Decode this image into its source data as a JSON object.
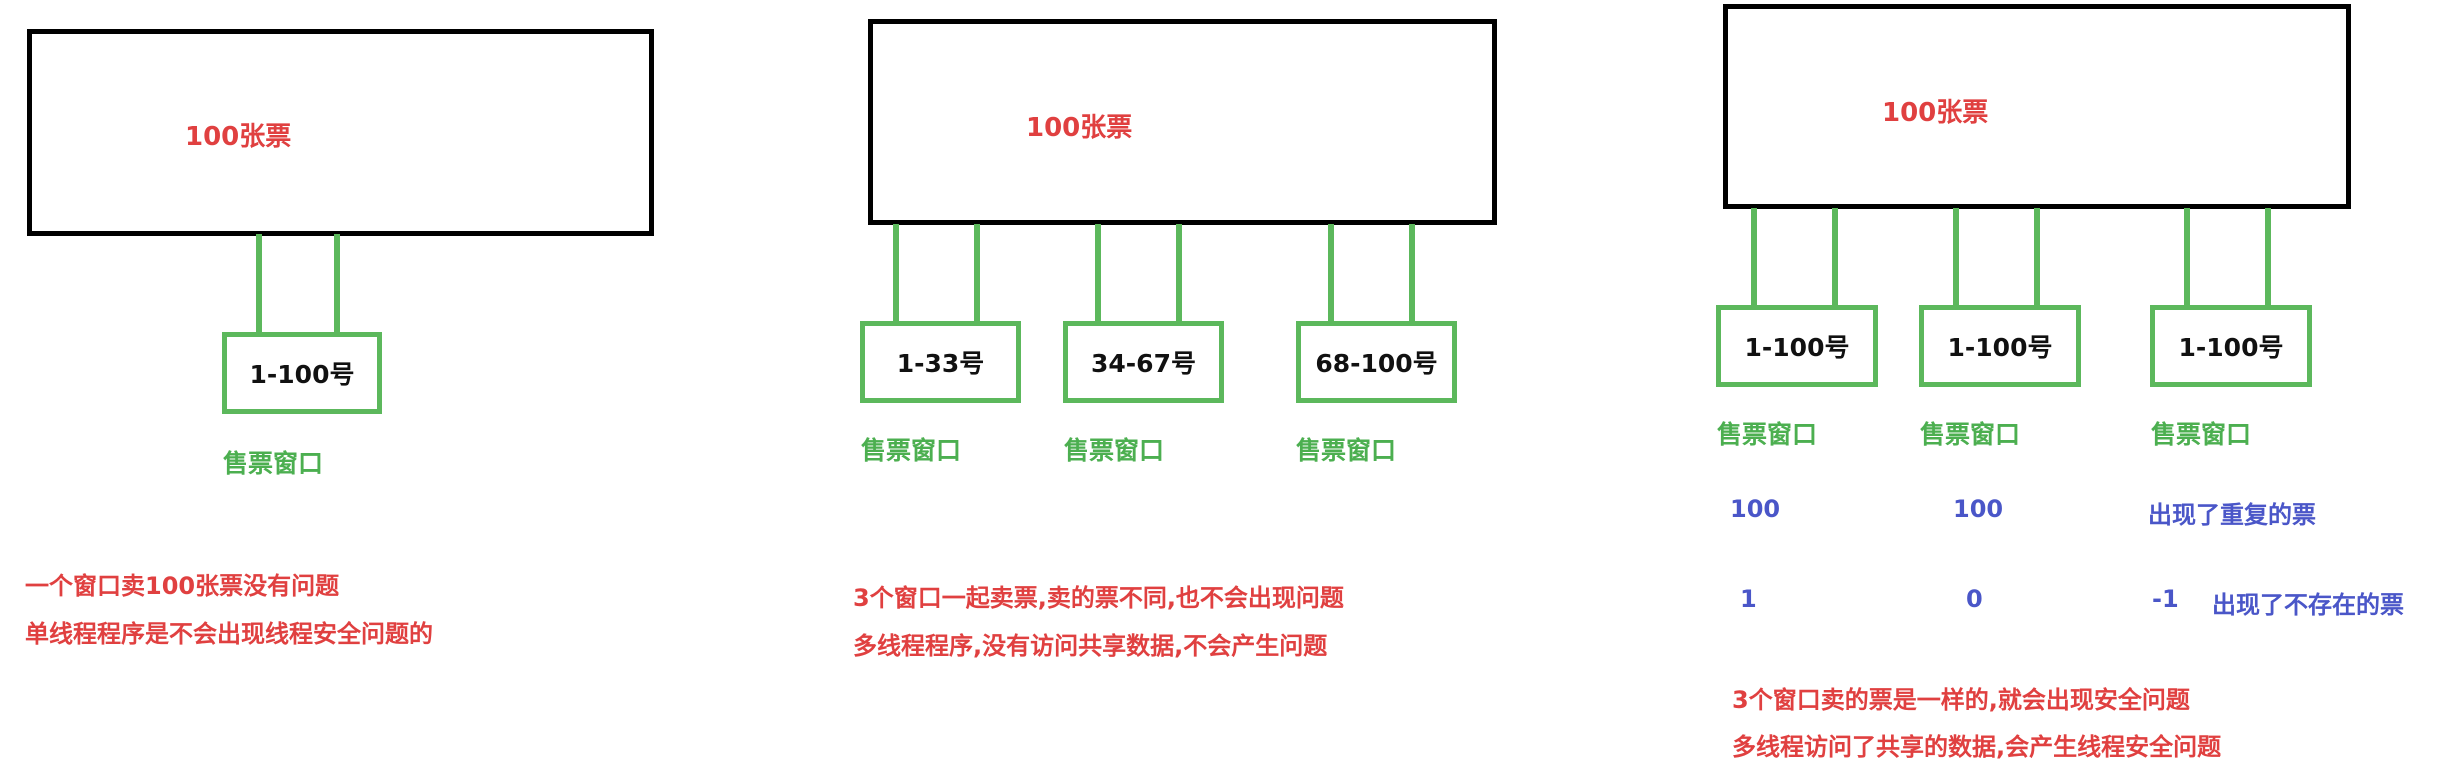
{
  "colors": {
    "box_border": "#000000",
    "wire": "#5cb85c",
    "red_text": "#e04040",
    "green_text": "#4caf50",
    "blue_text": "#4a56c8"
  },
  "scenario1": {
    "box_label": "100张票",
    "window": {
      "label": "1-100号",
      "caption": "售票窗口"
    },
    "notes": [
      "一个窗口卖100张票没有问题",
      "单线程程序是不会出现线程安全问题的"
    ]
  },
  "scenario2": {
    "box_label": "100张票",
    "windows": [
      {
        "label": "1-33号",
        "caption": "售票窗口"
      },
      {
        "label": "34-67号",
        "caption": "售票窗口"
      },
      {
        "label": "68-100号",
        "caption": "售票窗口"
      }
    ],
    "notes": [
      "3个窗口一起卖票,卖的票不同,也不会出现问题",
      "多线程程序,没有访问共享数据,不会产生问题"
    ]
  },
  "scenario3": {
    "box_label": "100张票",
    "windows": [
      {
        "label": "1-100号",
        "caption": "售票窗口",
        "v1": "100",
        "v2": "1"
      },
      {
        "label": "1-100号",
        "caption": "售票窗口",
        "v1": "100",
        "v2": "0"
      },
      {
        "label": "1-100号",
        "caption": "售票窗口",
        "v1": "出现了重复的票",
        "v2": "-1"
      }
    ],
    "extra": "出现了不存在的票",
    "notes": [
      "3个窗口卖的票是一样的,就会出现安全问题",
      "多线程访问了共享的数据,会产生线程安全问题"
    ]
  }
}
